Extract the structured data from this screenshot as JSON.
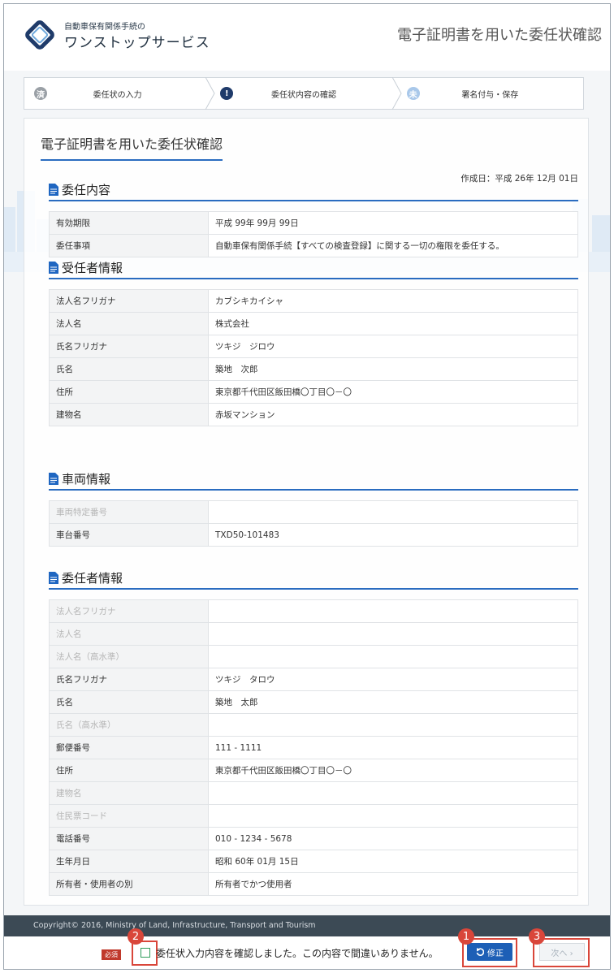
{
  "header": {
    "logo_small": "自動車保有関係手続の",
    "logo_big": "ワンストップサービス",
    "title": "電子証明書を用いた委任状確認"
  },
  "steps": [
    {
      "icon": "済",
      "label": "委任状の入力",
      "color": "#9aa0a6"
    },
    {
      "icon": "!",
      "label": "委任状内容の確認",
      "color": "#1f3b6a"
    },
    {
      "icon": "未",
      "label": "署名付与・保存",
      "color": "#a9c8ea"
    }
  ],
  "panel": {
    "title": "電子証明書を用いた委任状確認",
    "date_label": "作成日：平成 26年 12月 01日"
  },
  "sections": {
    "mandate": {
      "heading": "委任内容",
      "rows": [
        {
          "label": "有効期限",
          "value": "平成 99年 99月 99日"
        },
        {
          "label": "委任事項",
          "value": "自動車保有関係手続【すべての検査登録】に関する一切の権限を委任する。"
        }
      ]
    },
    "agent": {
      "heading": "受任者情報",
      "rows": [
        {
          "label": "法人名フリガナ",
          "value": "カブシキカイシャ"
        },
        {
          "label": "法人名",
          "value": "株式会社"
        },
        {
          "label": "氏名フリガナ",
          "value": "ツキジ　ジロウ"
        },
        {
          "label": "氏名",
          "value": "築地　次郎"
        },
        {
          "label": "住所",
          "value": "東京都千代田区飯田橋〇丁目〇－〇"
        },
        {
          "label": "建物名",
          "value": "赤坂マンション"
        }
      ]
    },
    "vehicle": {
      "heading": "車両情報",
      "rows": [
        {
          "label": "車両特定番号",
          "value": ""
        },
        {
          "label": "車台番号",
          "value": "TXD50-101483"
        }
      ]
    },
    "principal": {
      "heading": "委任者情報",
      "rows": [
        {
          "label": "法人名フリガナ",
          "value": ""
        },
        {
          "label": "法人名",
          "value": ""
        },
        {
          "label": "法人名（高水準）",
          "value": ""
        },
        {
          "label": "氏名フリガナ",
          "value": "ツキジ　タロウ"
        },
        {
          "label": "氏名",
          "value": "築地　太郎"
        },
        {
          "label": "氏名（高水準）",
          "value": ""
        },
        {
          "label": "郵便番号",
          "value": "111 - 1111"
        },
        {
          "label": "住所",
          "value": "東京都千代田区飯田橋〇丁目〇－〇"
        },
        {
          "label": "建物名",
          "value": ""
        },
        {
          "label": "住民票コード",
          "value": ""
        },
        {
          "label": "電話番号",
          "value": "010 - 1234 - 5678"
        },
        {
          "label": "生年月日",
          "value": "昭和 60年 01月 15日"
        },
        {
          "label": "所有者・使用者の別",
          "value": "所有者でかつ使用者"
        }
      ]
    }
  },
  "footer": {
    "copyright": "Copyright© 2016, Ministry of Land, Infrastructure, Transport and Tourism"
  },
  "bottombar": {
    "required_label": "必須",
    "confirm_text": "委任状入力内容を確認しました。この内容で間違いありません。",
    "edit_label": "修正",
    "next_label": "次へ ›",
    "badges": [
      "1",
      "2",
      "3"
    ]
  },
  "colors": {
    "accent": "#2a6cc0",
    "edit_button": "#1d5fb6",
    "highlight": "#d9463a",
    "footer_bg": "#3c4a55"
  }
}
